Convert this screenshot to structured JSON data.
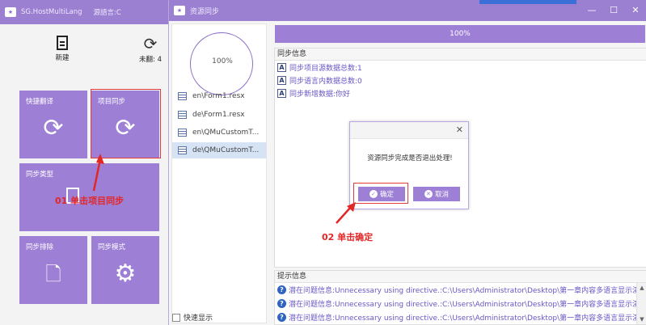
{
  "main_window": {
    "title": "SG.HostMultiLang",
    "language": "源語言:C",
    "toolbar": {
      "new_label": "新建",
      "untranslated_label": "未翻: 4"
    },
    "tiles": [
      {
        "label": "快捷翻译",
        "icon": "sync-icon"
      },
      {
        "label": "项目同步",
        "icon": "sync-icon"
      },
      {
        "label": "同步类型",
        "icon": "page-icon"
      },
      {
        "label": "同步排除",
        "icon": "file-gear-icon"
      },
      {
        "label": "同步模式",
        "icon": "gear-icon"
      }
    ]
  },
  "sync_window": {
    "title": "资源同步",
    "donut_label": "100%",
    "files": [
      "en\\Form1.resx",
      "de\\Form1.resx",
      "en\\QMuCustomT...",
      "de\\QMuCustomT..."
    ],
    "selected_file_index": 3,
    "quick_display_label": "快速显示",
    "progress": {
      "percent": 100,
      "label": "100%"
    },
    "info_header": "同步信息",
    "info_rows": [
      "同步项目源数据总数:1",
      "同步语言内数据总数:0",
      "同步新增数据:你好"
    ],
    "hint_header": "提示信息",
    "hint_rows": [
      "潜在问题信息:Unnecessary using directive.:C:\\Users\\Administrator\\Desktop\\第一章内容多语言显示演示代码\\",
      "潜在问题信息:Unnecessary using directive.:C:\\Users\\Administrator\\Desktop\\第一章内容多语言显示演示代码\\",
      "潜在问题信息:Unnecessary using directive.:C:\\Users\\Administrator\\Desktop\\第一章内容多语言显示演示代码\\"
    ]
  },
  "modal": {
    "message": "资源同步完成是否退出处理!",
    "ok_label": "确定",
    "cancel_label": "取消"
  },
  "annotations": {
    "step1": "01 单击项目同步",
    "step2": "02 单击确定"
  },
  "colors": {
    "accent": "#9d7fd6",
    "annotation_red": "#e32626",
    "link_purple": "#6a56c6"
  }
}
